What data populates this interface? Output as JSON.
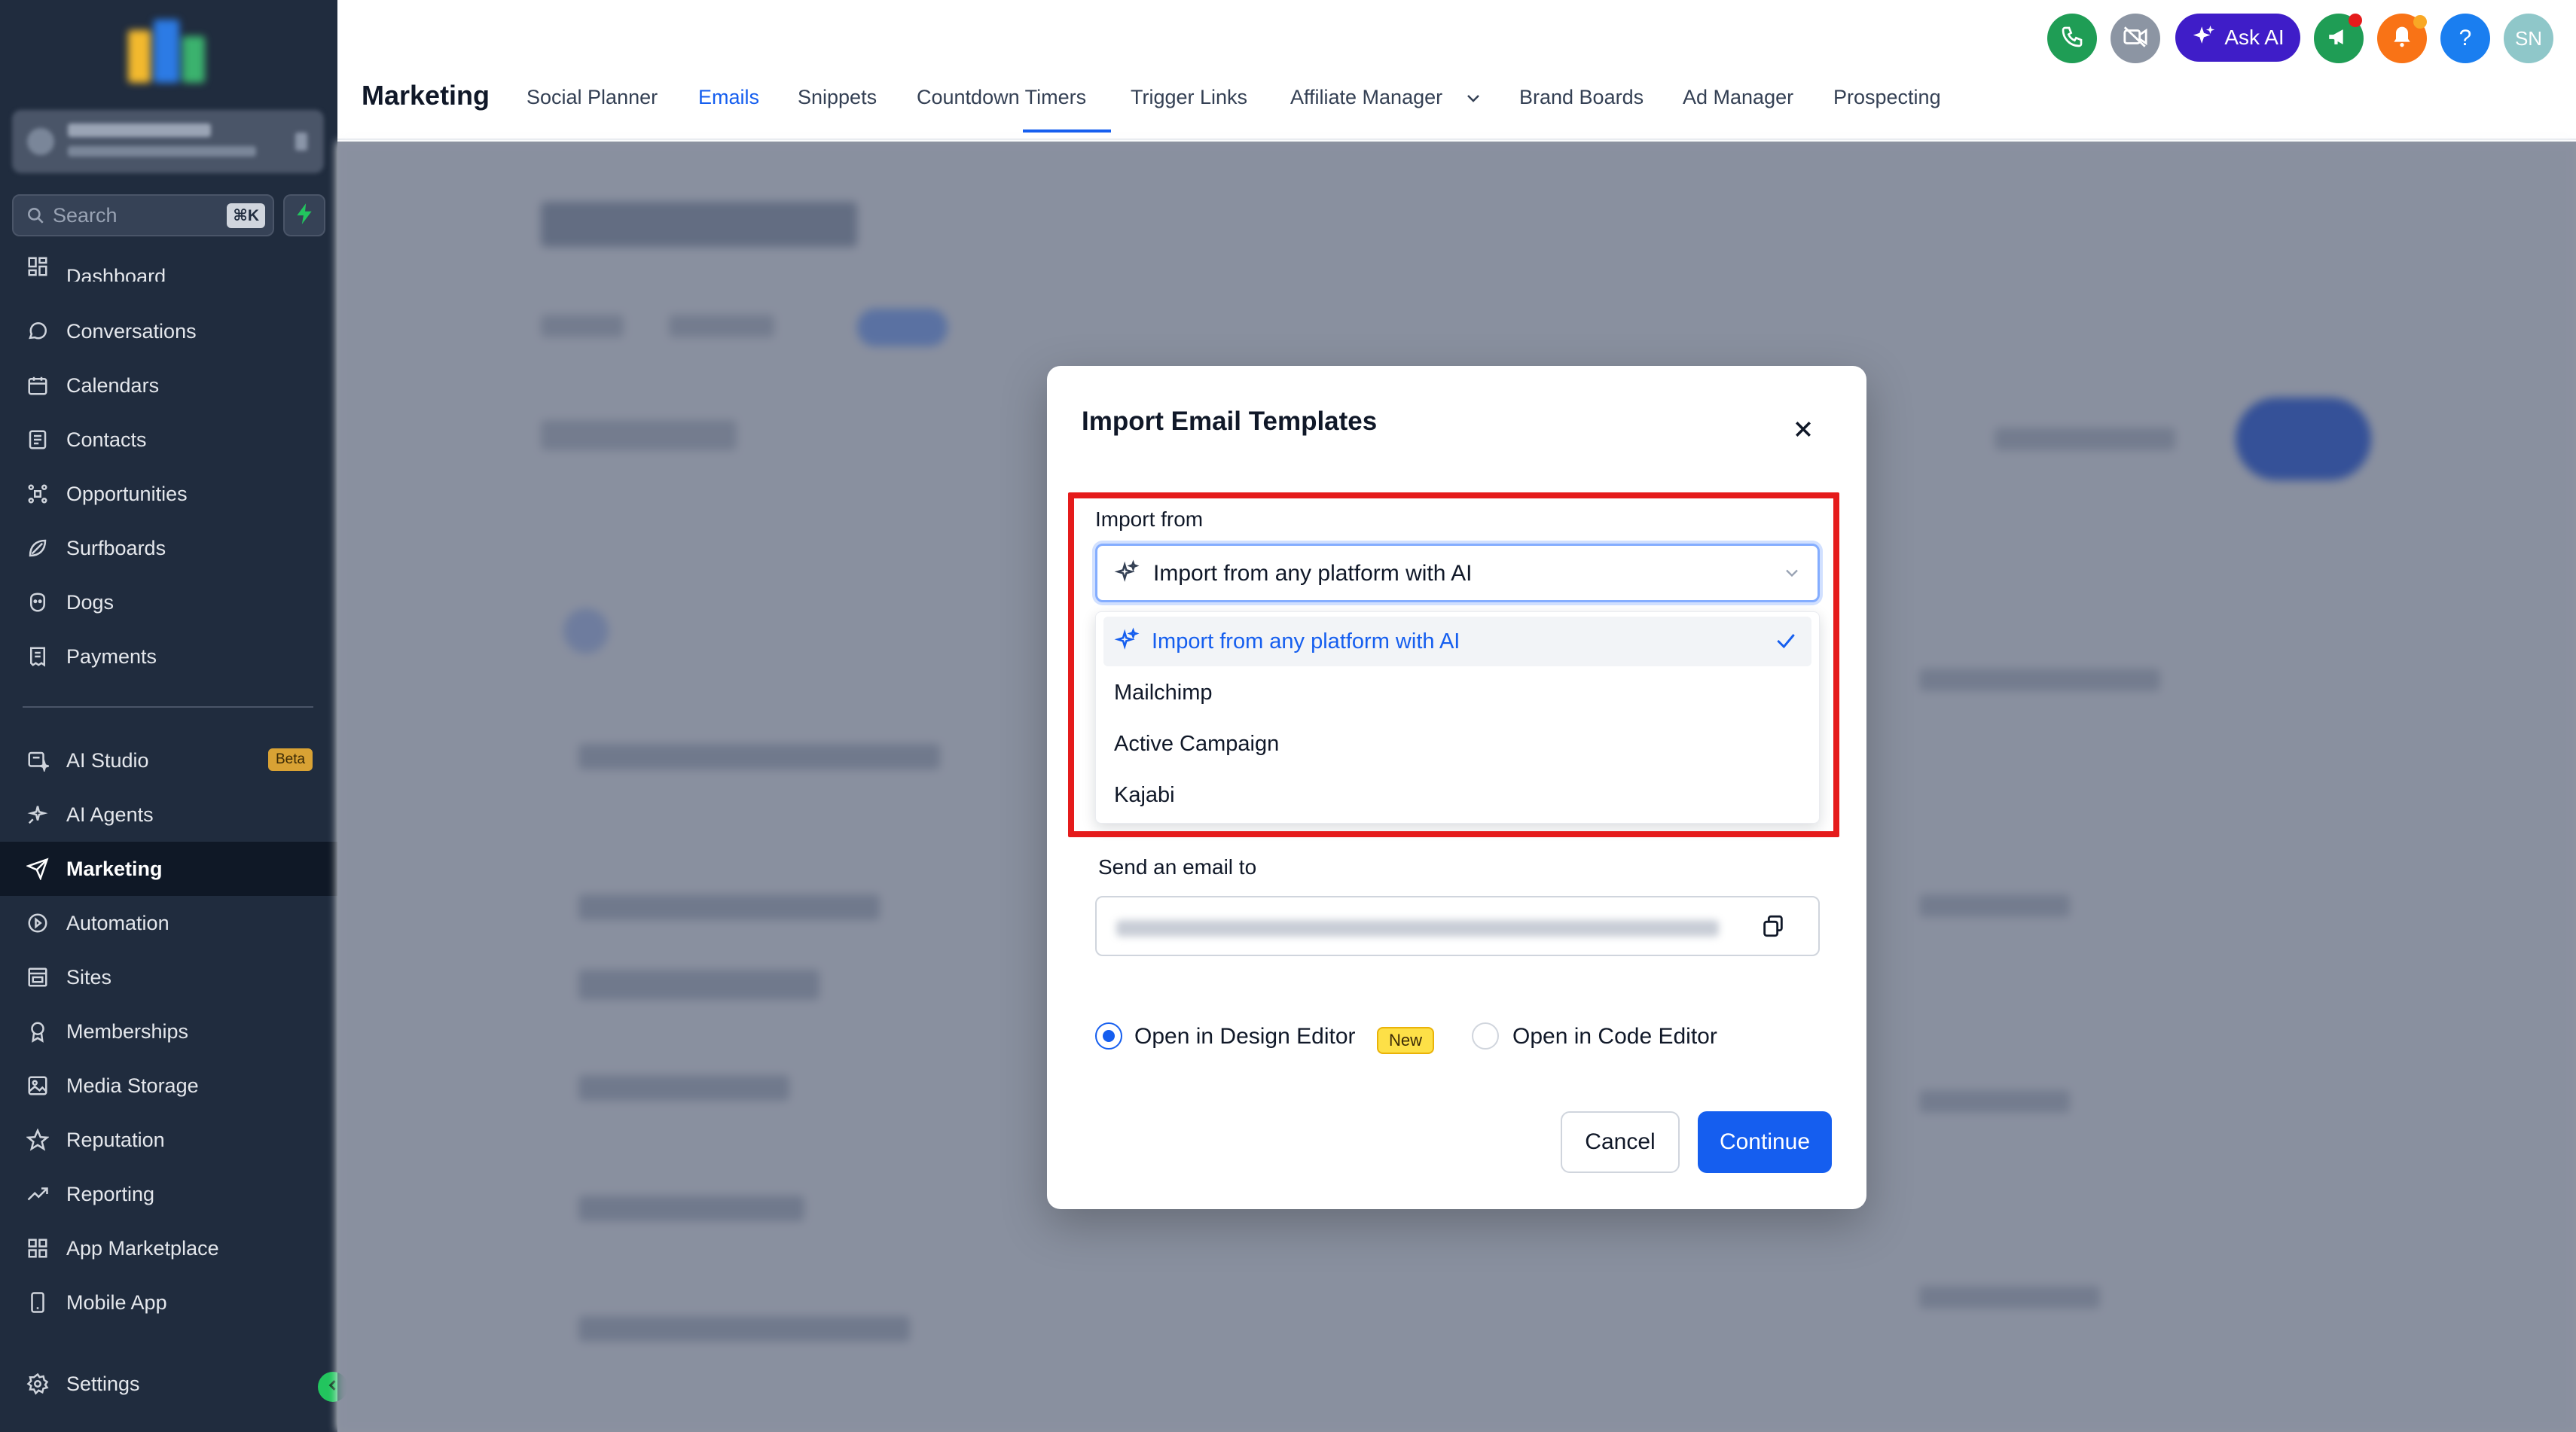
{
  "sidebar": {
    "search": {
      "label": "Search",
      "shortcut": "⌘K"
    },
    "items": [
      {
        "label": "Dashboard",
        "icon": "dashboard-icon"
      },
      {
        "label": "Conversations",
        "icon": "chat-icon"
      },
      {
        "label": "Calendars",
        "icon": "calendar-icon"
      },
      {
        "label": "Contacts",
        "icon": "contacts-icon"
      },
      {
        "label": "Opportunities",
        "icon": "opportunities-icon"
      },
      {
        "label": "Surfboards",
        "icon": "surfboard-icon"
      },
      {
        "label": "Dogs",
        "icon": "dog-icon"
      },
      {
        "label": "Payments",
        "icon": "receipt-icon"
      }
    ],
    "items2": [
      {
        "label": "AI Studio",
        "icon": "ai-studio-icon",
        "badge": "Beta"
      },
      {
        "label": "AI Agents",
        "icon": "ai-agents-icon"
      },
      {
        "label": "Marketing",
        "icon": "send-icon",
        "active": true
      },
      {
        "label": "Automation",
        "icon": "automation-icon"
      },
      {
        "label": "Sites",
        "icon": "sites-icon"
      },
      {
        "label": "Memberships",
        "icon": "membership-icon"
      },
      {
        "label": "Media Storage",
        "icon": "image-icon"
      },
      {
        "label": "Reputation",
        "icon": "star-icon"
      },
      {
        "label": "Reporting",
        "icon": "trend-icon"
      },
      {
        "label": "App Marketplace",
        "icon": "grid-icon"
      },
      {
        "label": "Mobile App",
        "icon": "mobile-icon"
      }
    ],
    "settings": {
      "label": "Settings",
      "icon": "gear-icon"
    }
  },
  "header": {
    "title": "Marketing",
    "tabs": [
      "Social Planner",
      "Emails",
      "Snippets",
      "Countdown Timers",
      "Trigger Links",
      "Affiliate Manager",
      "Brand Boards",
      "Ad Manager",
      "Prospecting"
    ],
    "active_tab": "Emails",
    "ask_ai": "Ask AI",
    "help": "?",
    "avatar_initials": "SN"
  },
  "modal": {
    "title": "Import Email Templates",
    "import_from_label": "Import from",
    "selected_value": "Import from any platform with AI",
    "options": [
      "Import from any platform with AI",
      "Mailchimp",
      "Active Campaign",
      "Kajabi"
    ],
    "send_email_label": "Send an email to",
    "radio_design": "Open in Design Editor",
    "radio_design_badge": "New",
    "radio_code": "Open in Code Editor",
    "selected_editor": "design",
    "cancel": "Cancel",
    "continue": "Continue"
  },
  "colors": {
    "primary": "#155eef",
    "sidebar_bg": "#202c3e",
    "highlight": "#e51b1b",
    "ask_ai_bg": "#3f1dc8",
    "beta_badge": "#d9a234",
    "new_badge": "#fde047"
  }
}
